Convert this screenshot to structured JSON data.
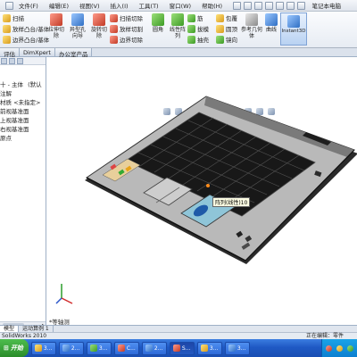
{
  "menubar": {
    "items": [
      "文件(F)",
      "编辑(E)",
      "视图(V)",
      "插入(I)",
      "工具(T)",
      "窗口(W)",
      "帮助(H)"
    ],
    "document_title": "笔记本电脑"
  },
  "ribbon": {
    "sweep": "扫描",
    "loft_boss": "放样凸台/基体",
    "boundary_boss": "边界凸台/基体",
    "extrude_cut": "拉伸切除",
    "hole_wizard": "异型孔向导",
    "revolve_cut": "旋转切除",
    "swept_cut": "扫描切除",
    "lofted_cut": "放样切割",
    "boundary_cut": "边界切除",
    "fillet": "圆角",
    "linear_pattern": "线性阵列",
    "rib": "筋",
    "draft": "拔模",
    "shell": "抽壳",
    "wrap": "包覆",
    "dome": "圆顶",
    "mirror": "镜向",
    "reference_geometry": "参考几何体",
    "curves": "曲线",
    "instant3d": "Instant3D"
  },
  "tabs": [
    "评估",
    "DimXpert",
    "办公室产品"
  ],
  "tree": {
    "header": "十 - 主体",
    "extra": "(默认",
    "items": [
      "注解",
      "材质 <未指定>",
      "前视基准面",
      "上视基准面",
      "右视基准面",
      "原点"
    ]
  },
  "viewport": {
    "tooltip": "阵列(线性)10",
    "view_label": "*等轴测"
  },
  "model_tabs": [
    "模型",
    "运动算例 1"
  ],
  "status": {
    "left": "SolidWorks 2010",
    "right": "正在编辑：零件"
  },
  "taskbar": {
    "start_label": "开始",
    "buttons": [
      "3...",
      "2...",
      "3...",
      "C...",
      "2...",
      "S...",
      "3...",
      "3..."
    ]
  }
}
